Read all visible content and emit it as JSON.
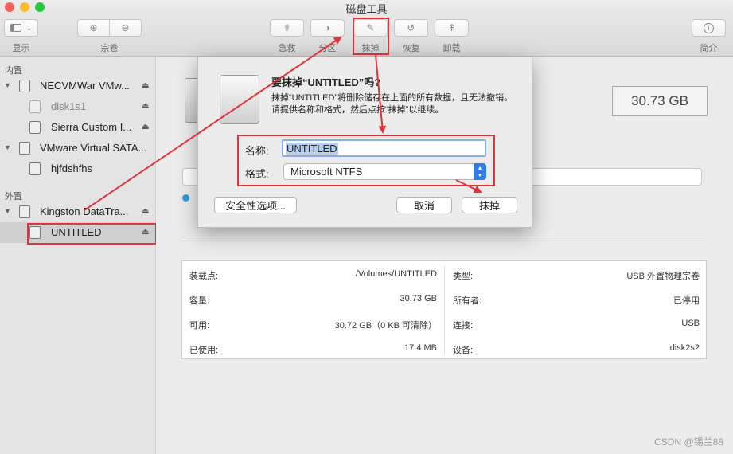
{
  "window": {
    "title": "磁盘工具"
  },
  "toolbar": {
    "view_label": "显示",
    "volume_label": "宗卷",
    "first_aid_label": "急救",
    "partition_label": "分区",
    "erase_label": "抹掉",
    "restore_label": "恢复",
    "unmount_label": "卸载",
    "info_label": "简介"
  },
  "sidebar": {
    "internal_header": "内置",
    "external_header": "外置",
    "items": [
      {
        "label": "NECVMWar VMw..."
      },
      {
        "label": "disk1s1"
      },
      {
        "label": "Sierra Custom I..."
      },
      {
        "label": "VMware Virtual SATA..."
      },
      {
        "label": "hjfdshfhs"
      },
      {
        "label": "Kingston DataTra..."
      },
      {
        "label": "UNTITLED"
      }
    ]
  },
  "main": {
    "capacity": "30.73 GB"
  },
  "dialog": {
    "title": "要抹掉“UNTITLED”吗?",
    "message": "抹掉“UNTITLED”将删除储存在上面的所有数据，且无法撤销。请提供名称和格式，然后点按“抹掉”以继续。",
    "name_label": "名称:",
    "name_value": "UNTITLED",
    "format_label": "格式:",
    "format_value": "Microsoft NTFS",
    "security_button": "安全性选项...",
    "cancel_button": "取消",
    "erase_button": "抹掉"
  },
  "info": {
    "mount_point_label": "装载点:",
    "mount_point_value": "/Volumes/UNTITLED",
    "capacity_label": "容量:",
    "capacity_value": "30.73 GB",
    "available_label": "可用:",
    "available_value": "30.72 GB（0 KB 可清除）",
    "used_label": "已使用:",
    "used_value": "17.4 MB",
    "type_label": "类型:",
    "type_value": "USB 外置物理宗卷",
    "owners_label": "所有者:",
    "owners_value": "已停用",
    "connection_label": "连接:",
    "connection_value": "USB",
    "device_label": "设备:",
    "device_value": "disk2s2"
  },
  "watermark": "CSDN @锡兰88",
  "colors": {
    "annotation_red": "#e0353a",
    "selection_blue": "#b3d0f3",
    "popup_blue": "#2f7be8"
  }
}
